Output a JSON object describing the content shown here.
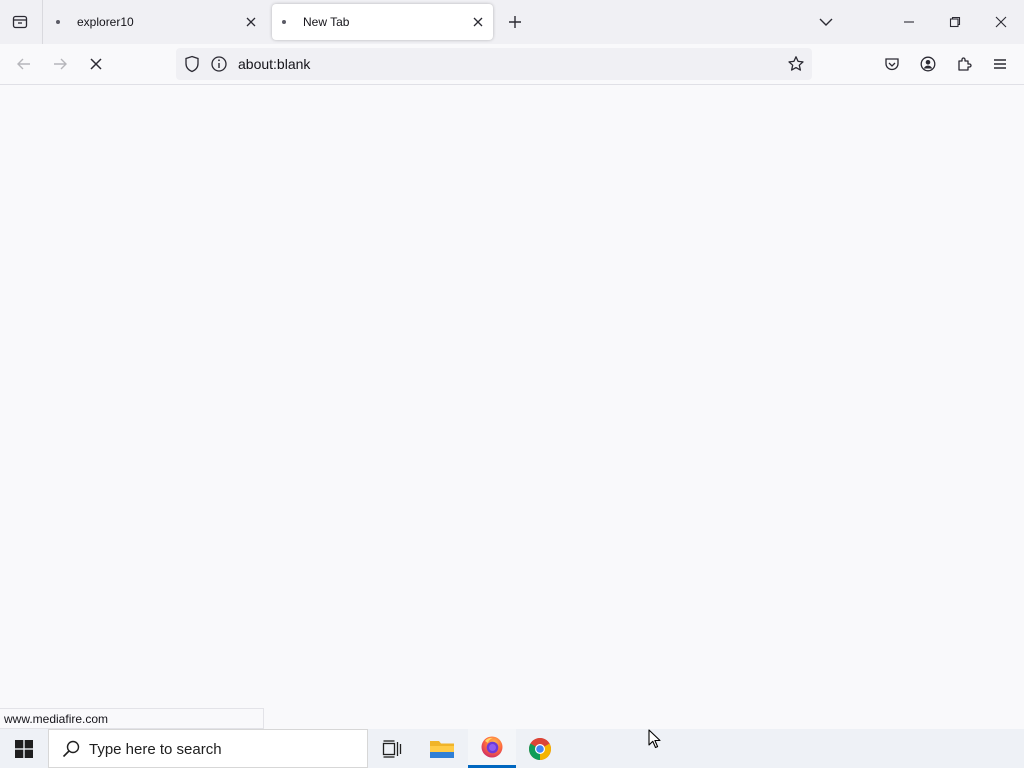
{
  "browser": {
    "tabs": [
      {
        "title": "explorer10",
        "active": false
      },
      {
        "title": "New Tab",
        "active": true
      }
    ],
    "url": "about:blank",
    "status_text": "www.mediafire.com",
    "loading": true
  },
  "taskbar": {
    "search_placeholder": "Type here to search",
    "apps": [
      "task-view",
      "file-explorer",
      "firefox",
      "chrome"
    ],
    "active_app": "firefox"
  },
  "icons": {
    "tab_list": "tab-list-icon",
    "close": "close-icon",
    "new_tab": "plus-icon",
    "dropdown": "chevron-down-icon",
    "back": "arrow-left-icon",
    "forward": "arrow-right-icon",
    "stop": "stop-icon",
    "shield": "shield-icon",
    "info": "info-icon",
    "bookmark": "star-icon",
    "pocket": "pocket-icon",
    "account": "account-icon",
    "extensions": "puzzle-icon",
    "menu": "hamburger-icon"
  },
  "colors": {
    "accent": "#0067c0",
    "tabstrip_bg": "#f0f0f4",
    "page_bg": "#f9f9fb"
  }
}
